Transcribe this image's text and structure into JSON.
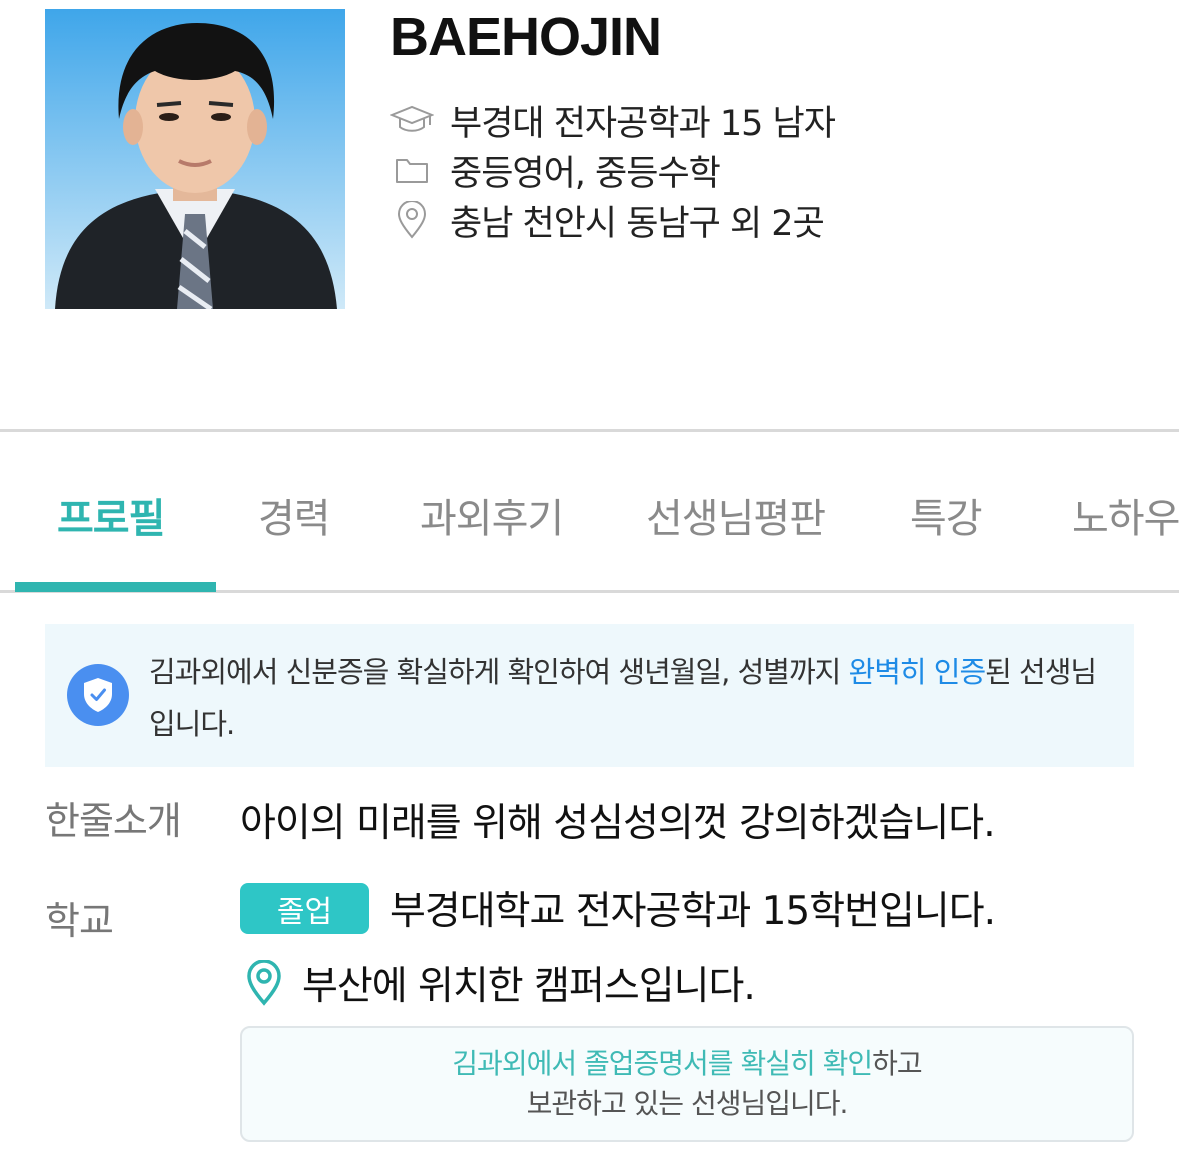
{
  "profile": {
    "name": "BAEHOJIN",
    "school_line": "부경대 전자공학과 15 남자",
    "subjects": "중등영어, 중등수학",
    "location": "충남 천안시 동남구 외 2곳",
    "icons": {
      "school": "graduation-cap-icon",
      "subjects": "folder-icon",
      "location": "location-pin-icon"
    }
  },
  "tabs": [
    {
      "label": "프로필",
      "active": true
    },
    {
      "label": "경력",
      "active": false
    },
    {
      "label": "과외후기",
      "active": false
    },
    {
      "label": "선생님평판",
      "active": false
    },
    {
      "label": "특강",
      "active": false
    },
    {
      "label": "노하우",
      "active": false
    }
  ],
  "verification": {
    "text_before": "김과외에서 신분증을 확실하게 확인하여 생년월일, 성별까지 ",
    "highlight": "완벽히 인증",
    "text_after": "된 선생님입니다.",
    "icon": "shield-check-icon"
  },
  "intro": {
    "label": "한줄소개",
    "text": "아이의 미래를 위해 성심성의껏 강의하겠습니다."
  },
  "school": {
    "label": "학교",
    "badge": "졸업",
    "text": "부경대학교 전자공학과 15학번입니다.",
    "campus": "부산에 위치한 캠퍼스입니다.",
    "cert_highlight": "김과외에서 졸업증명서를 확실히 확인",
    "cert_line1_rest": "하고",
    "cert_line2": "보관하고 있는 선생님입니다."
  },
  "colors": {
    "accent": "#2fb5b0",
    "link_blue": "#1e8be6",
    "badge": "#2ec6c6",
    "banner_bg": "#eef8fc"
  }
}
